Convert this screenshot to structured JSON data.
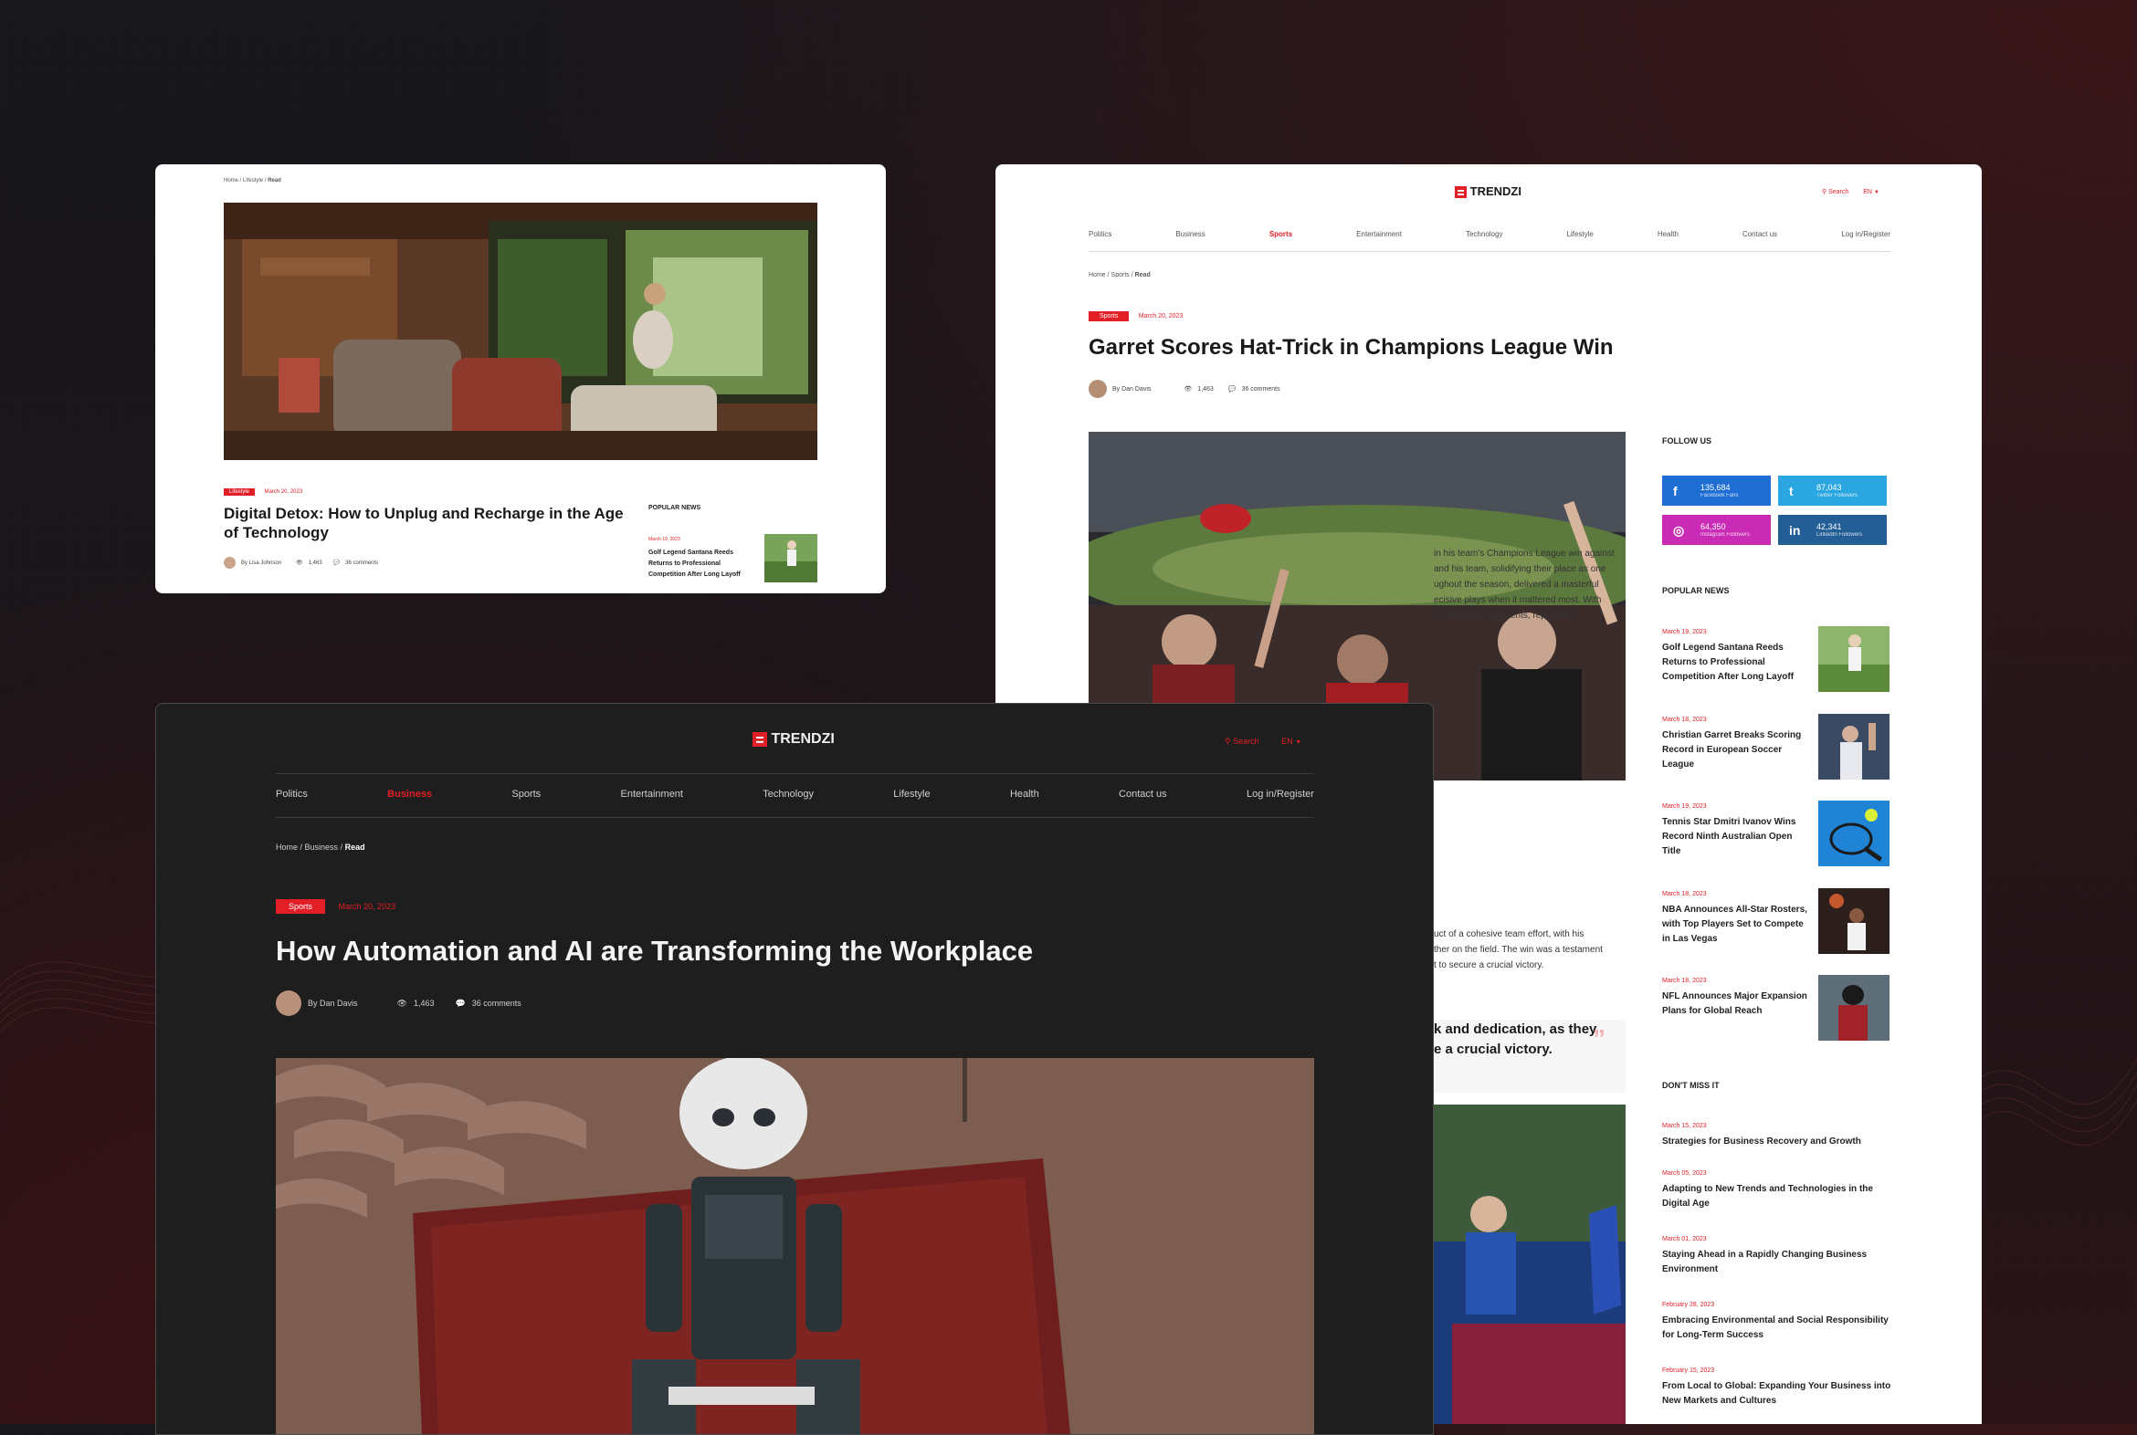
{
  "brand": "TRENDZI",
  "colors": {
    "accent": "#e21f26",
    "dark_bg": "#1e1e1e",
    "light_bg": "#ffffff"
  },
  "card_top_left": {
    "breadcrumb": {
      "home": "Home",
      "section": "Lifestyle",
      "current": "Read"
    },
    "tag": "Lifestyle",
    "date": "March 20, 2023",
    "title": "Digital Detox: How to Unplug and Recharge in the Age of Technology",
    "author": "By Lisa Johnson",
    "views": "1,463",
    "comments": "36 comments",
    "popular_heading": "POPULAR NEWS",
    "popular_item": {
      "date": "March 19, 2023",
      "title": "Golf Legend Santana Reeds Returns to Professional Competition After Long Layoff"
    }
  },
  "card_right": {
    "search_label": "Search",
    "lang": "EN",
    "nav": [
      "Politics",
      "Business",
      "Sports",
      "Entertainment",
      "Technology",
      "Lifestyle",
      "Health",
      "Contact us",
      "Log in/Register"
    ],
    "active_nav": "Sports",
    "breadcrumb": {
      "home": "Home",
      "section": "Sports",
      "current": "Read"
    },
    "tag": "Sports",
    "date": "March 20, 2023",
    "title": "Garret Scores Hat-Trick in Champions League Win",
    "author": "By Dan Davis",
    "views": "1,463",
    "comments": "36 comments",
    "body_lines_1": [
      "in his team's Champions League win against",
      "and his team, solidifying their place as one",
      "ughout the season, delivered a masterful",
      "ecisive plays when it mattered most. With",
      "e side of his opponents, repeatedly"
    ],
    "body_lines_2": [
      "uct of a cohesive team effort, with his",
      "ther on the field. The win was a testament",
      "t to secure a crucial victory."
    ],
    "quote_lines": [
      "k and dedication, as they",
      "e a crucial victory."
    ],
    "follow_heading": "FOLLOW US",
    "social": [
      {
        "name": "facebook",
        "icon": "f",
        "count": "135,684",
        "sub": "Facebook Fans",
        "color": "#1f6ed4"
      },
      {
        "name": "twitter",
        "icon": "t",
        "count": "87,043",
        "sub": "Twitter Followers",
        "color": "#2aa6e0"
      },
      {
        "name": "instagram",
        "icon": "◎",
        "count": "64,350",
        "sub": "Instagram Followers",
        "color": "#c92bb5"
      },
      {
        "name": "linkedin",
        "icon": "in",
        "count": "42,341",
        "sub": "LinkedIn Followers",
        "color": "#235f96"
      }
    ],
    "popular_heading": "POPULAR NEWS",
    "popular": [
      {
        "date": "March 19, 2023",
        "title": "Golf Legend Santana Reeds Returns to Professional Competition After Long Layoff",
        "img": "golf"
      },
      {
        "date": "March 18, 2023",
        "title": "Christian Garret Breaks Scoring Record in European Soccer League",
        "img": "soccer"
      },
      {
        "date": "March 19, 2023",
        "title": "Tennis Star Dmitri Ivanov Wins Record Ninth Australian Open Title",
        "img": "tennis"
      },
      {
        "date": "March 18, 2023",
        "title": "NBA Announces All-Star Rosters, with Top Players Set to Compete in Las Vegas",
        "img": "nba"
      },
      {
        "date": "March 18, 2023",
        "title": "NFL Announces Major Expansion Plans for Global Reach",
        "img": "nfl"
      }
    ],
    "dont_miss_heading": "DON'T MISS IT",
    "dont_miss": [
      {
        "date": "March 15, 2023",
        "title": "Strategies for Business Recovery and Growth"
      },
      {
        "date": "March 05, 2023",
        "title": "Adapting to New Trends and Technologies in the Digital Age"
      },
      {
        "date": "March 01, 2023",
        "title": "Staying Ahead in a Rapidly Changing Business Environment"
      },
      {
        "date": "February 28, 2023",
        "title": "Embracing Environmental and Social Responsibility for Long-Term Success"
      },
      {
        "date": "February 15, 2023",
        "title": "From Local to Global: Expanding Your Business into New Markets and Cultures"
      }
    ]
  },
  "card_dark": {
    "search_label": "Search",
    "lang": "EN",
    "nav": [
      "Politics",
      "Business",
      "Sports",
      "Entertainment",
      "Technology",
      "Lifestyle",
      "Health",
      "Contact us",
      "Log in/Register"
    ],
    "active_nav": "Business",
    "breadcrumb": {
      "home": "Home",
      "section": "Business",
      "current": "Read"
    },
    "tag": "Sports",
    "date": "March 20, 2023",
    "title": "How Automation and AI are Transforming the Workplace",
    "author": "By Dan Davis",
    "views": "1,463",
    "comments": "36 comments"
  }
}
